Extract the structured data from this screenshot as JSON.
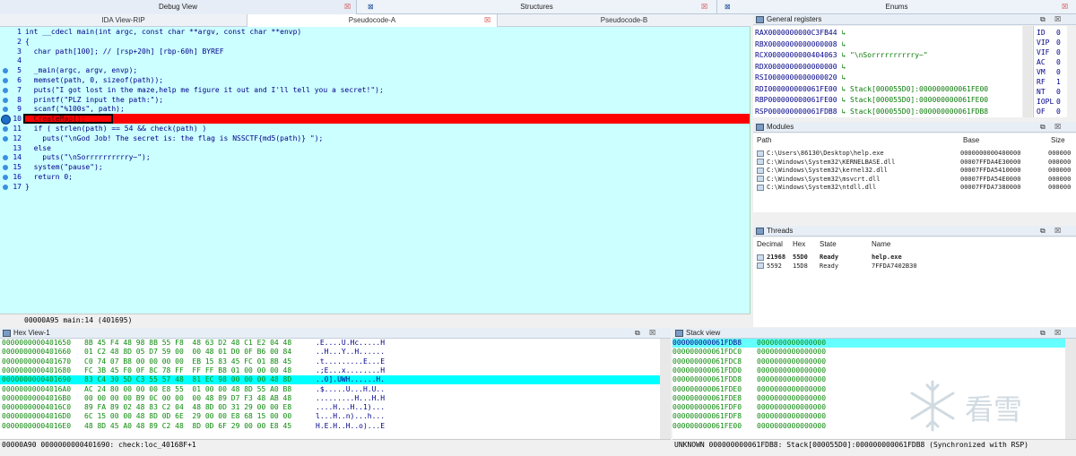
{
  "tabs": {
    "debug_view": "Debug View",
    "structures": "Structures",
    "enums": "Enums"
  },
  "subtabs": {
    "ida_view": "IDA View-RIP",
    "pseudo_a": "Pseudocode-A",
    "pseudo_b": "Pseudocode-B"
  },
  "code": {
    "lines": [
      {
        "n": "1",
        "dot": false,
        "text": "int __cdecl main(int argc, const char **argv, const char **envp)"
      },
      {
        "n": "2",
        "dot": false,
        "text": "{"
      },
      {
        "n": "3",
        "dot": false,
        "text": "  char path[100]; // [rsp+20h] [rbp-60h] BYREF"
      },
      {
        "n": "4",
        "dot": false,
        "text": ""
      },
      {
        "n": "5",
        "dot": true,
        "text": "  _main(argc, argv, envp);"
      },
      {
        "n": "6",
        "dot": true,
        "text": "  memset(path, 0, sizeof(path));"
      },
      {
        "n": "7",
        "dot": true,
        "text": "  puts(\"I got lost in the maze,help me figure it out and I'll tell you a secret!\");"
      },
      {
        "n": "8",
        "dot": true,
        "text": "  printf(\"PLZ input the path:\");"
      },
      {
        "n": "9",
        "dot": true,
        "text": "  scanf(\"%100s\", path);"
      },
      {
        "n": "10",
        "dot": true,
        "text": "  CreateMap();"
      },
      {
        "n": "11",
        "dot": true,
        "text": "  if ( strlen(path) == 54 && check(path) )"
      },
      {
        "n": "12",
        "dot": true,
        "text": "    puts(\"\\nGod Job! The secret is: the flag is NSSCTF{md5(path)} \");"
      },
      {
        "n": "13",
        "dot": false,
        "text": "  else"
      },
      {
        "n": "14",
        "dot": true,
        "text": "    puts(\"\\nSorrrrrrrrrry~\");"
      },
      {
        "n": "15",
        "dot": true,
        "text": "  system(\"pause\");"
      },
      {
        "n": "16",
        "dot": true,
        "text": "  return 0;"
      },
      {
        "n": "17",
        "dot": true,
        "text": "}"
      }
    ],
    "status": "00000A95 main:14 (401695)"
  },
  "registers": {
    "title": "General registers",
    "rows": [
      {
        "name": "RAX",
        "value": "0000000000C3FB44",
        "comment": ""
      },
      {
        "name": "RBX",
        "value": "0000000000000008",
        "comment": ""
      },
      {
        "name": "RCX",
        "value": "0000000000404063",
        "comment": "\"\\nSorrrrrrrrrry~\""
      },
      {
        "name": "RDX",
        "value": "0000000000000000",
        "comment": ""
      },
      {
        "name": "RSI",
        "value": "0000000000000020",
        "comment": ""
      },
      {
        "name": "RDI",
        "value": "000000000061FE00",
        "comment": "Stack[000055D0]:000000000061FE00"
      },
      {
        "name": "RBP",
        "value": "000000000061FE00",
        "comment": "Stack[000055D0]:000000000061FE00"
      },
      {
        "name": "RSP",
        "value": "000000000061FDB8",
        "comment": "Stack[000055D0]:000000000061FDB8"
      }
    ],
    "flags": [
      {
        "name": "ID",
        "value": "0"
      },
      {
        "name": "VIP",
        "value": "0"
      },
      {
        "name": "VIF",
        "value": "0"
      },
      {
        "name": "AC",
        "value": "0"
      },
      {
        "name": "VM",
        "value": "0"
      },
      {
        "name": "RF",
        "value": "1"
      },
      {
        "name": "NT",
        "value": "0"
      },
      {
        "name": "IOPL",
        "value": "0"
      },
      {
        "name": "OF",
        "value": "0"
      }
    ]
  },
  "modules": {
    "title": "Modules",
    "col_path": "Path",
    "col_base": "Base",
    "col_size": "Size",
    "rows": [
      {
        "path": "C:\\Users\\86130\\Desktop\\help.exe",
        "base": "0000000000400000",
        "size": "000000"
      },
      {
        "path": "C:\\Windows\\System32\\KERNELBASE.dll",
        "base": "00007FFDA4E30000",
        "size": "000000"
      },
      {
        "path": "C:\\Windows\\System32\\kernel32.dll",
        "base": "00007FFDA5410000",
        "size": "000000"
      },
      {
        "path": "C:\\Windows\\System32\\msvcrt.dll",
        "base": "00007FFDA54E0000",
        "size": "000000"
      },
      {
        "path": "C:\\Windows\\System32\\ntdll.dll",
        "base": "00007FFDA7380000",
        "size": "000000"
      }
    ]
  },
  "threads": {
    "title": "Threads",
    "col_decimal": "Decimal",
    "col_hex": "Hex",
    "col_state": "State",
    "col_name": "Name",
    "rows": [
      {
        "decimal": "21968",
        "hex": "55D0",
        "state": "Ready",
        "name": "help.exe"
      },
      {
        "decimal": "5592",
        "hex": "15D8",
        "state": "Ready",
        "name": "7FFDA7402B30"
      }
    ]
  },
  "hex_view": {
    "title": "Hex View-1",
    "rows": [
      {
        "addr": "0000000000401650",
        "bytes": "8B 45 F4 48 98 8B 55 F8  48 63 D2 48 C1 E2 04 48",
        "ascii": ".E....U.Hc.....H"
      },
      {
        "addr": "0000000000401660",
        "bytes": "01 C2 48 8D 05 D7 59 00  00 48 01 D0 0F B6 00 84",
        "ascii": "..H...Y..H......"
      },
      {
        "addr": "0000000000401670",
        "bytes": "C0 74 07 B8 00 00 00 00  EB 15 83 45 FC 01 8B 45",
        "ascii": ".t.........E...E"
      },
      {
        "addr": "0000000000401680",
        "bytes": "FC 3B 45 F0 0F 8C 78 FF  FF FF B8 01 00 00 00 48",
        "ascii": ".;E...x........H"
      },
      {
        "addr": "0000000000401690",
        "bytes": "83 C4 30 5D C3 55 57 48  81 EC 98 00 00 00 48 8D",
        "ascii": "..0].UWH......H."
      },
      {
        "addr": "00000000004016A0",
        "bytes": "AC 24 80 00 00 00 E8 55  01 00 00 48 8D 55 A0 B8",
        "ascii": ".$.....U...H.U.."
      },
      {
        "addr": "00000000004016B0",
        "bytes": "00 00 00 00 B9 0C 00 00  00 48 89 D7 F3 48 AB 48",
        "ascii": ".........H...H.H"
      },
      {
        "addr": "00000000004016C0",
        "bytes": "89 FA 89 02 48 83 C2 04  48 8D 0D 31 29 00 00 E8",
        "ascii": "....H...H..1)..."
      },
      {
        "addr": "00000000004016D0",
        "bytes": "6C 15 00 00 48 8D 0D 6E  29 00 00 E8 68 15 00 00",
        "ascii": "l...H..n)...h..."
      },
      {
        "addr": "00000000004016E0",
        "bytes": "48 8D 45 A0 48 89 C2 48  8D 0D 6F 29 00 00 E8 45",
        "ascii": "H.E.H..H..o)...E"
      }
    ],
    "status": "00000A90 0000000000401690: check:loc_40168F+1"
  },
  "stack_view": {
    "title": "Stack view",
    "rows": [
      {
        "addr": "000000000061FDB8",
        "value": "0000000000000000"
      },
      {
        "addr": "000000000061FDC0",
        "value": "0000000000000000"
      },
      {
        "addr": "000000000061FDC8",
        "value": "0000000000000000"
      },
      {
        "addr": "000000000061FDD0",
        "value": "0000000000000000"
      },
      {
        "addr": "000000000061FDD8",
        "value": "0000000000000000"
      },
      {
        "addr": "000000000061FDE0",
        "value": "0000000000000000"
      },
      {
        "addr": "000000000061FDE8",
        "value": "0000000000000000"
      },
      {
        "addr": "000000000061FDF0",
        "value": "0000000000000000"
      },
      {
        "addr": "000000000061FDF8",
        "value": "0000000000000000"
      },
      {
        "addr": "000000000061FE00",
        "value": "0000000000000000"
      }
    ],
    "status": "UNKNOWN 000000000061FDB8: Stack[000055D0]:000000000061FDB8 (Synchronized with RSP)"
  },
  "watermark": {
    "text": "看雪"
  },
  "colors": {
    "code_bg": "#ccffff",
    "highlight": "#ff0000",
    "breakpoint": "#1e6fc8",
    "stack_sel": "#66ffff"
  }
}
